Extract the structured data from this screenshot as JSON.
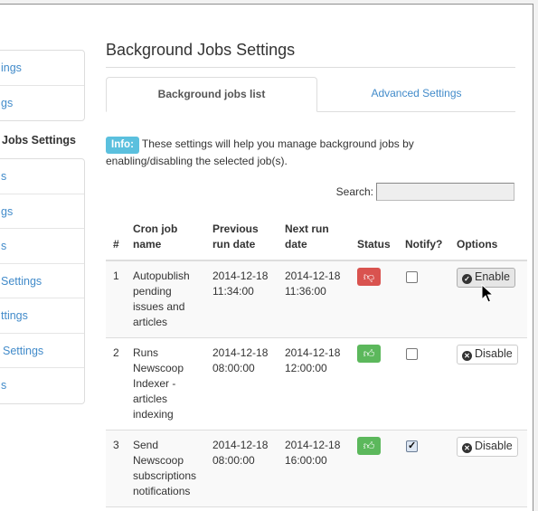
{
  "sidebar": {
    "group1": [
      {
        "label": "ings"
      },
      {
        "label": "gs"
      }
    ],
    "heading": "Jobs Settings",
    "group2": [
      {
        "label": "s"
      },
      {
        "label": "gs"
      },
      {
        "label": "s"
      },
      {
        "label": "Settings"
      },
      {
        "label": "ttings"
      },
      {
        "label": " Settings"
      },
      {
        "label": "s"
      }
    ]
  },
  "main": {
    "title": "Background Jobs Settings",
    "tabs": [
      {
        "label": "Background jobs list",
        "active": true
      },
      {
        "label": "Advanced Settings",
        "active": false
      }
    ],
    "info": {
      "label": "Info:",
      "text": "These settings will help you manage background jobs by enabling/disabling the selected job(s)."
    },
    "search": {
      "label": "Search:",
      "value": ""
    },
    "table": {
      "headers": [
        "#",
        "Cron job name",
        "Previous run date",
        "Next run date",
        "Status",
        "Notify?",
        "Options"
      ],
      "rows": [
        {
          "num": "1",
          "name": "Autopublish pending issues and articles",
          "prev": "2014-12-18 11:34:00",
          "next": "2014-12-18 11:36:00",
          "status": "disabled",
          "status_icon": "thumbs-down-icon",
          "notify": false,
          "option": "Enable"
        },
        {
          "num": "2",
          "name": "Runs Newscoop Indexer - articles indexing",
          "prev": "2014-12-18 08:00:00",
          "next": "2014-12-18 12:00:00",
          "status": "enabled",
          "status_icon": "thumbs-up-icon",
          "notify": false,
          "option": "Disable"
        },
        {
          "num": "3",
          "name": "Send Newscoop subscriptions notifications",
          "prev": "2014-12-18 08:00:00",
          "next": "2014-12-18 16:00:00",
          "status": "enabled",
          "status_icon": "thumbs-up-icon",
          "notify": true,
          "option": "Disable"
        }
      ]
    }
  },
  "colors": {
    "link": "#428bca",
    "info": "#5bc0de",
    "danger": "#d9534f",
    "success": "#5cb85c"
  }
}
